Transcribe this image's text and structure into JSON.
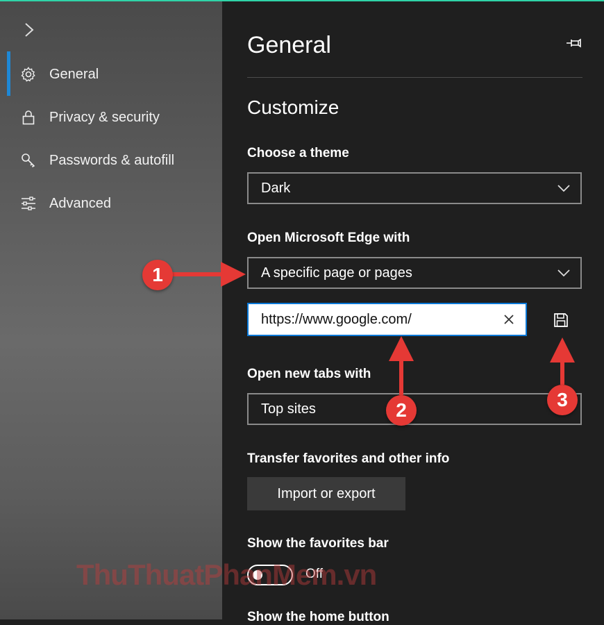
{
  "sidebar": {
    "items": [
      {
        "label": "General",
        "icon": "gear-icon",
        "active": true
      },
      {
        "label": "Privacy & security",
        "icon": "lock-icon"
      },
      {
        "label": "Passwords & autofill",
        "icon": "key-icon"
      },
      {
        "label": "Advanced",
        "icon": "sliders-icon"
      }
    ]
  },
  "panel": {
    "title": "General",
    "section": "Customize",
    "theme": {
      "label": "Choose a theme",
      "value": "Dark"
    },
    "open_with": {
      "label": "Open Microsoft Edge with",
      "value": "A specific page or pages"
    },
    "url": {
      "value": "https://www.google.com/"
    },
    "new_tabs": {
      "label": "Open new tabs with",
      "value": "Top sites"
    },
    "transfer": {
      "label": "Transfer favorites and other info",
      "button": "Import or export"
    },
    "favorites_bar": {
      "label": "Show the favorites bar",
      "state": "Off"
    },
    "next_label": "Show the home button"
  },
  "annotations": {
    "badge1": "1",
    "badge2": "2",
    "badge3": "3"
  },
  "watermark": "ThuThuatPhanMem.vn",
  "colors": {
    "accent": "#0a78d7",
    "annotation": "#e53935",
    "border_top": "#2fd4a8"
  }
}
